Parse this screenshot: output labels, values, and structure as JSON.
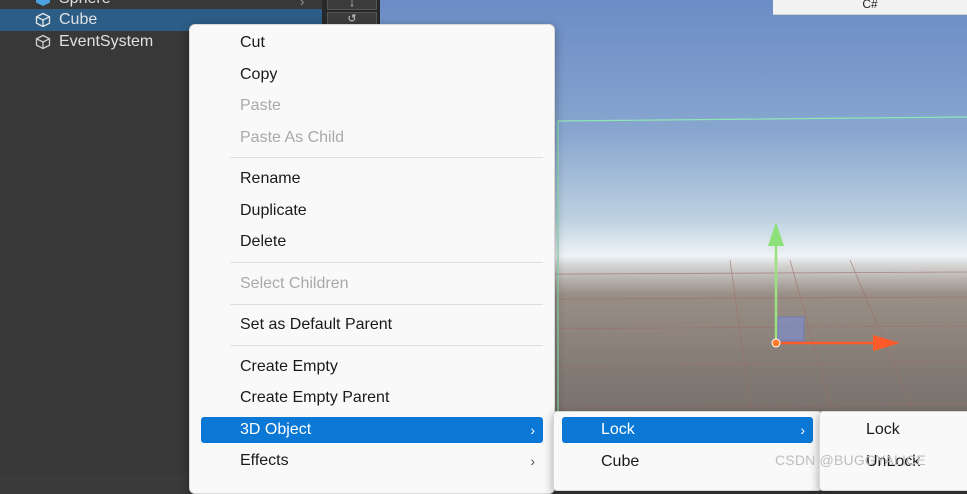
{
  "hierarchy": {
    "items": [
      {
        "label": "Sphere",
        "state": "partial"
      },
      {
        "label": "Cube",
        "state": "selected"
      },
      {
        "label": "EventSystem",
        "state": "normal"
      }
    ]
  },
  "scene": {
    "top_window_text": "C#",
    "colors": {
      "sky": "#6b8cc6",
      "ground": "#807872",
      "axis_y": "#8ee07a",
      "axis_x": "#ff5a2a",
      "selection_outline": "#7fe0a0"
    }
  },
  "context_menu": {
    "items": [
      {
        "label": "Cut",
        "enabled": true
      },
      {
        "label": "Copy",
        "enabled": true
      },
      {
        "label": "Paste",
        "enabled": false
      },
      {
        "label": "Paste As Child",
        "enabled": false
      },
      {
        "label": "Rename",
        "enabled": true
      },
      {
        "label": "Duplicate",
        "enabled": true
      },
      {
        "label": "Delete",
        "enabled": true
      },
      {
        "label": "Select Children",
        "enabled": false
      },
      {
        "label": "Set as Default Parent",
        "enabled": true
      },
      {
        "label": "Create Empty",
        "enabled": true
      },
      {
        "label": "Create Empty Parent",
        "enabled": true
      },
      {
        "label": "3D Object",
        "enabled": true,
        "highlighted": true,
        "submenu": true
      },
      {
        "label": "Effects",
        "enabled": true,
        "submenu": true
      }
    ],
    "submenu_arrow": "›"
  },
  "submenu_3d": {
    "items": [
      {
        "label": "Lock",
        "highlighted": true,
        "submenu": true
      },
      {
        "label": "Cube"
      }
    ]
  },
  "submenu_lock": {
    "items": [
      {
        "label": "Lock"
      },
      {
        "label": "UnLock"
      }
    ]
  },
  "watermark": "CSDN @BUGGYALICE",
  "accent_color": "#0a78d4"
}
